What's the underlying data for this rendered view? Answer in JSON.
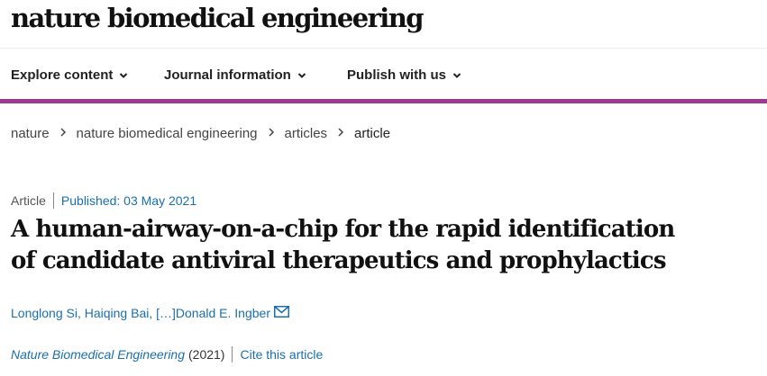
{
  "brand": {
    "name": "nature biomedical engineering"
  },
  "nav": {
    "items": [
      {
        "label": "Explore content"
      },
      {
        "label": "Journal information"
      },
      {
        "label": "Publish with us"
      }
    ]
  },
  "breadcrumb": {
    "items": [
      "nature",
      "nature biomedical engineering",
      "articles",
      "article"
    ]
  },
  "article": {
    "type": "Article",
    "published": "Published: 03 May 2021",
    "title_line1": "A human-airway-on-a-chip for the rapid identification",
    "title_line2": "of candidate antiviral therapeutics and prophylactics",
    "authors": {
      "first": "Longlong Si",
      "separator1": ", ",
      "second": "Haiqing Bai",
      "separator2": ", ",
      "ellipsis": "[…]",
      "last": "Donald E. Ingber"
    },
    "journal": "Nature Biomedical Engineering",
    "year": "(2021)",
    "cite_label": "Cite this article"
  },
  "colors": {
    "accent": "#9c3a8f",
    "link": "#1a6fb0",
    "text": "#222222"
  },
  "icons": {
    "nav_chevron": "chevron-down-icon",
    "breadcrumb_separator": "chevron-right-icon",
    "email": "email-icon"
  }
}
